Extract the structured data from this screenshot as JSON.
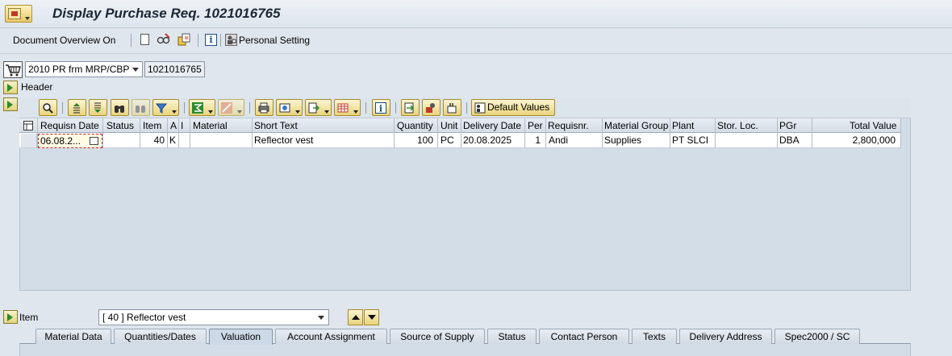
{
  "window": {
    "title": "Display Purchase Req. 1021016765"
  },
  "toolbar": {
    "document_overview": "Document Overview On",
    "personal_setting": "Personal Setting"
  },
  "doc": {
    "type_selected": "2010 PR frm MRP/CBP",
    "number": "1021016765"
  },
  "header": {
    "label": "Header"
  },
  "grid_toolbar": {
    "default_values": "Default Values"
  },
  "table": {
    "columns": [
      "Requisn Date",
      "Status",
      "Item",
      "A",
      "I",
      "Material",
      "Short Text",
      "Quantity",
      "Unit",
      "Delivery Date",
      "Per",
      "Requisnr.",
      "Material Group",
      "Plant",
      "Stor. Loc.",
      "PGr",
      "Total Value"
    ],
    "rows": [
      {
        "requisn_date": "06.08.2...",
        "status": "",
        "item": "40",
        "a": "K",
        "i": "",
        "material": "",
        "short_text": "Reflector vest",
        "quantity": "100",
        "unit": "PC",
        "delivery_date": "20.08.2025",
        "per": "1",
        "requisnr": "Andi",
        "material_group": "Supplies",
        "plant": "PT SLCI",
        "stor_loc": "",
        "pgr": "DBA",
        "total_value": "2,800,000"
      }
    ]
  },
  "item": {
    "label": "Item",
    "selected": "[ 40 ] Reflector vest"
  },
  "tabs": [
    {
      "label": "Material Data"
    },
    {
      "label": "Quantities/Dates"
    },
    {
      "label": "Valuation",
      "active": true
    },
    {
      "label": "Account Assignment"
    },
    {
      "label": "Source of Supply"
    },
    {
      "label": "Status"
    },
    {
      "label": "Contact Person"
    },
    {
      "label": "Texts"
    },
    {
      "label": "Delivery Address"
    },
    {
      "label": "Spec2000 / SC"
    }
  ],
  "colors": {
    "background": "#dfe6ee",
    "panel": "#d3dde8",
    "button_gold": "#e9d37c",
    "error_border": "#d02020"
  }
}
